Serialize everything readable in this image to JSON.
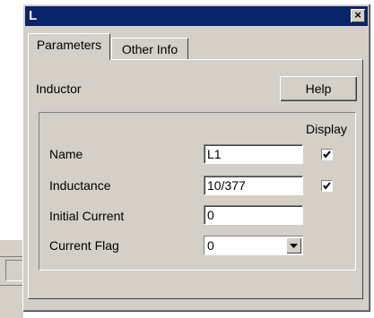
{
  "window": {
    "title": "L",
    "close_glyph": "×"
  },
  "tabs": [
    {
      "label": "Parameters",
      "active": true
    },
    {
      "label": "Other Info",
      "active": false
    }
  ],
  "component": {
    "type_label": "Inductor",
    "help_label": "Help"
  },
  "params": {
    "display_header": "Display",
    "rows": [
      {
        "label": "Name",
        "value": "L1",
        "display_checked": true
      },
      {
        "label": "Inductance",
        "value": "10/377",
        "display_checked": true
      },
      {
        "label": "Initial Current",
        "value": "0"
      },
      {
        "label": "Current Flag",
        "value": "0"
      }
    ]
  },
  "icons": {
    "close": "close-icon",
    "checkmark": "check-icon",
    "dropdown": "chevron-down-icon"
  },
  "colors": {
    "titlebar": "#0a246a",
    "face": "#d4d0c8",
    "field": "#ffffff"
  }
}
